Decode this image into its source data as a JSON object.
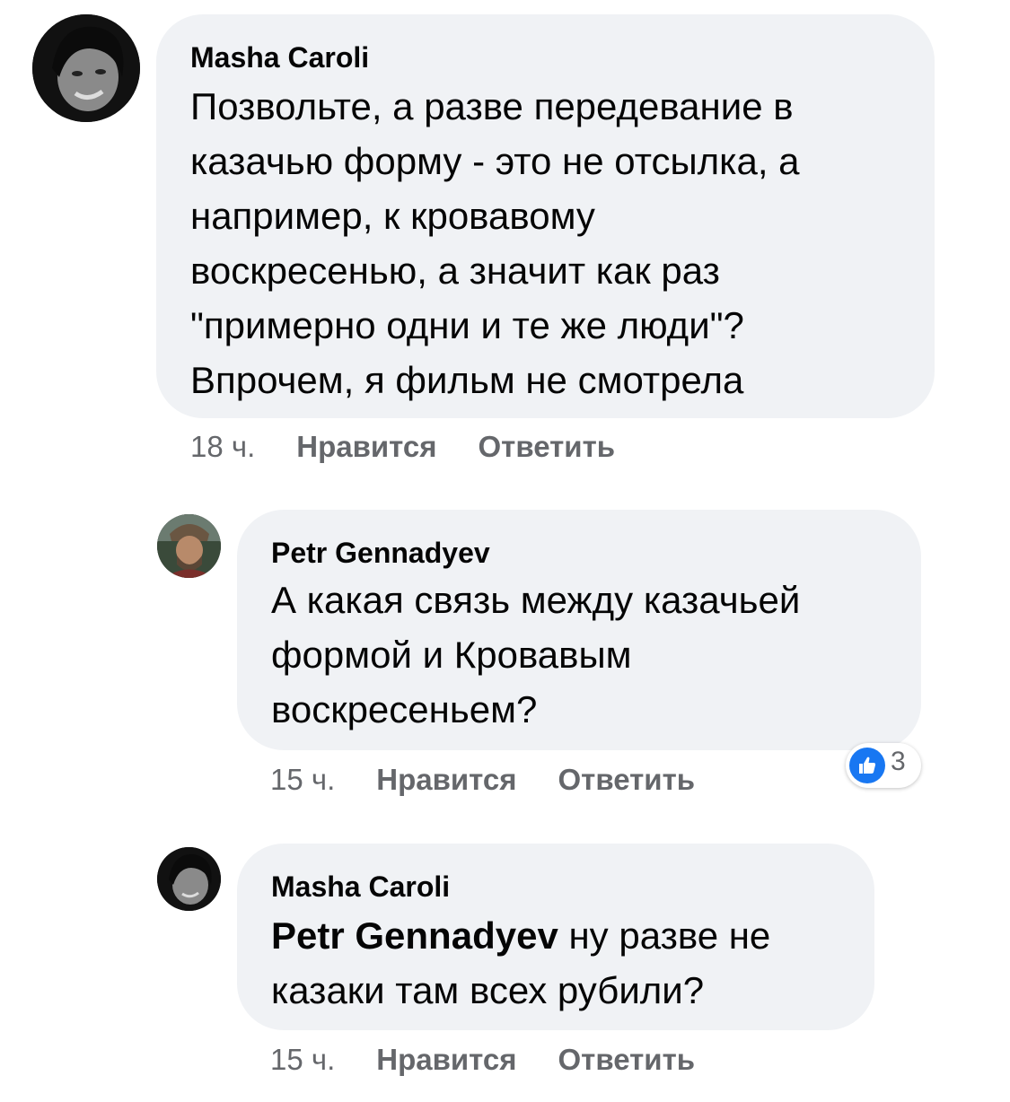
{
  "comments": [
    {
      "author": "Masha Caroli",
      "text": "Позвольте, а разве передевание в\nказачью форму - это не отсылка, а\nнапример, к кровавому\nвоскресенью, а значит как раз\n\"примерно одни и те же люди\"?\nВпрочем, я фильм не смотрела",
      "time": "18 ч.",
      "like_label": "Нравится",
      "reply_label": "Ответить"
    },
    {
      "author": "Petr Gennadyev",
      "text": "А какая связь между казачьей\nформой и Кровавым\nвоскресеньем?",
      "time": "15 ч.",
      "like_label": "Нравится",
      "reply_label": "Ответить",
      "reaction_count": "3",
      "reaction_icon": "like-icon",
      "reaction_color": "#1877f2"
    },
    {
      "author": "Masha Caroli",
      "mention": "Petr Gennadyev",
      "text_line1": " ну разве не",
      "text_line2": "казаки там всех рубили?",
      "time": "15 ч.",
      "like_label": "Нравится",
      "reply_label": "Ответить"
    }
  ],
  "colors": {
    "bubble": "#f0f2f5",
    "meta_text": "#65676b",
    "primary_text": "#050505",
    "like_blue": "#1877f2"
  }
}
